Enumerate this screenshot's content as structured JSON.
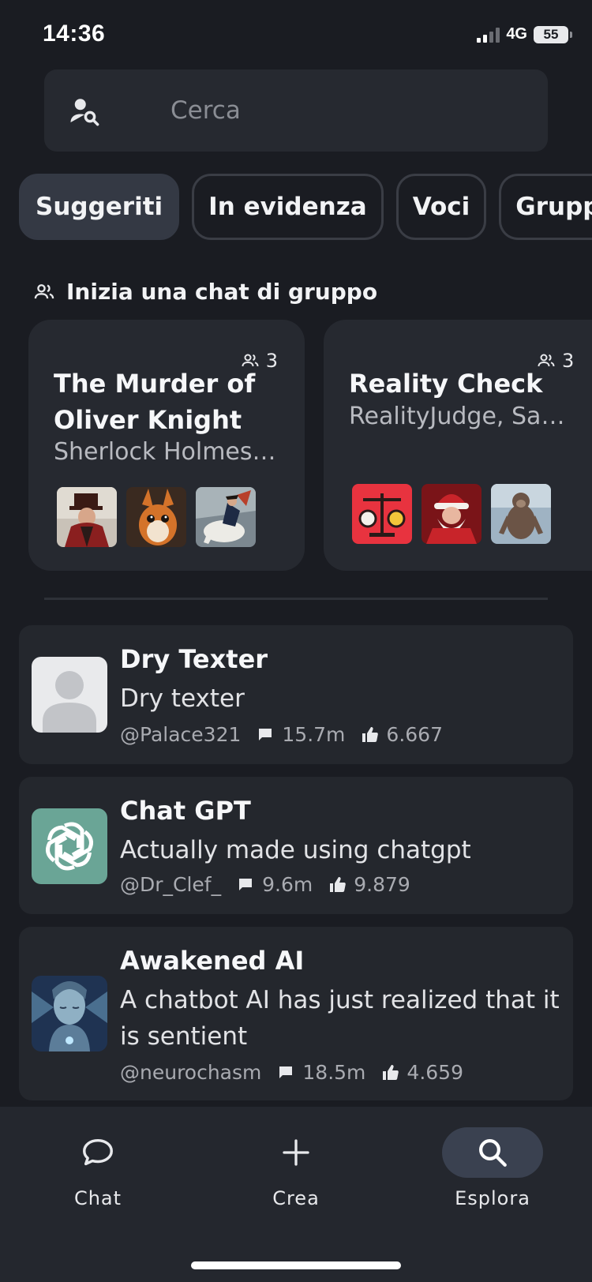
{
  "status": {
    "time": "14:36",
    "network": "4G",
    "battery": "55"
  },
  "search": {
    "placeholder": "Cerca"
  },
  "tabs": [
    {
      "label": "Suggeriti",
      "active": true
    },
    {
      "label": "In evidenza",
      "active": false
    },
    {
      "label": "Voci",
      "active": false
    },
    {
      "label": "Gruppi",
      "active": false
    }
  ],
  "group_section": {
    "title": "Inizia una chat di gruppo",
    "cards": [
      {
        "count": "3",
        "title": "The Murder of Oliver Knight",
        "members": "Sherlock Holmes,…"
      },
      {
        "count": "3",
        "title": "Reality Check",
        "members": "RealityJudge, San…"
      }
    ]
  },
  "bots": [
    {
      "name": "Dry Texter",
      "description": "Dry texter",
      "author": "@Palace321",
      "chats": "15.7m",
      "likes": "6.667"
    },
    {
      "name": "Chat GPT",
      "description": "Actually made using chatgpt",
      "author": "@Dr_Clef_",
      "chats": "9.6m",
      "likes": "9.879"
    },
    {
      "name": "Awakened AI",
      "description": "A chatbot AI has just realized that it is sentient",
      "author": "@neurochasm",
      "chats": "18.5m",
      "likes": "4.659"
    }
  ],
  "nav": [
    {
      "label": "Chat",
      "icon": "chat-bubble-icon"
    },
    {
      "label": "Crea",
      "icon": "plus-icon"
    },
    {
      "label": "Esplora",
      "icon": "search-icon",
      "active": true
    }
  ],
  "colors": {
    "background": "#1a1c22",
    "card": "#262930",
    "accent_pill": "#3a4150",
    "chatgpt_green": "#6aa596"
  }
}
